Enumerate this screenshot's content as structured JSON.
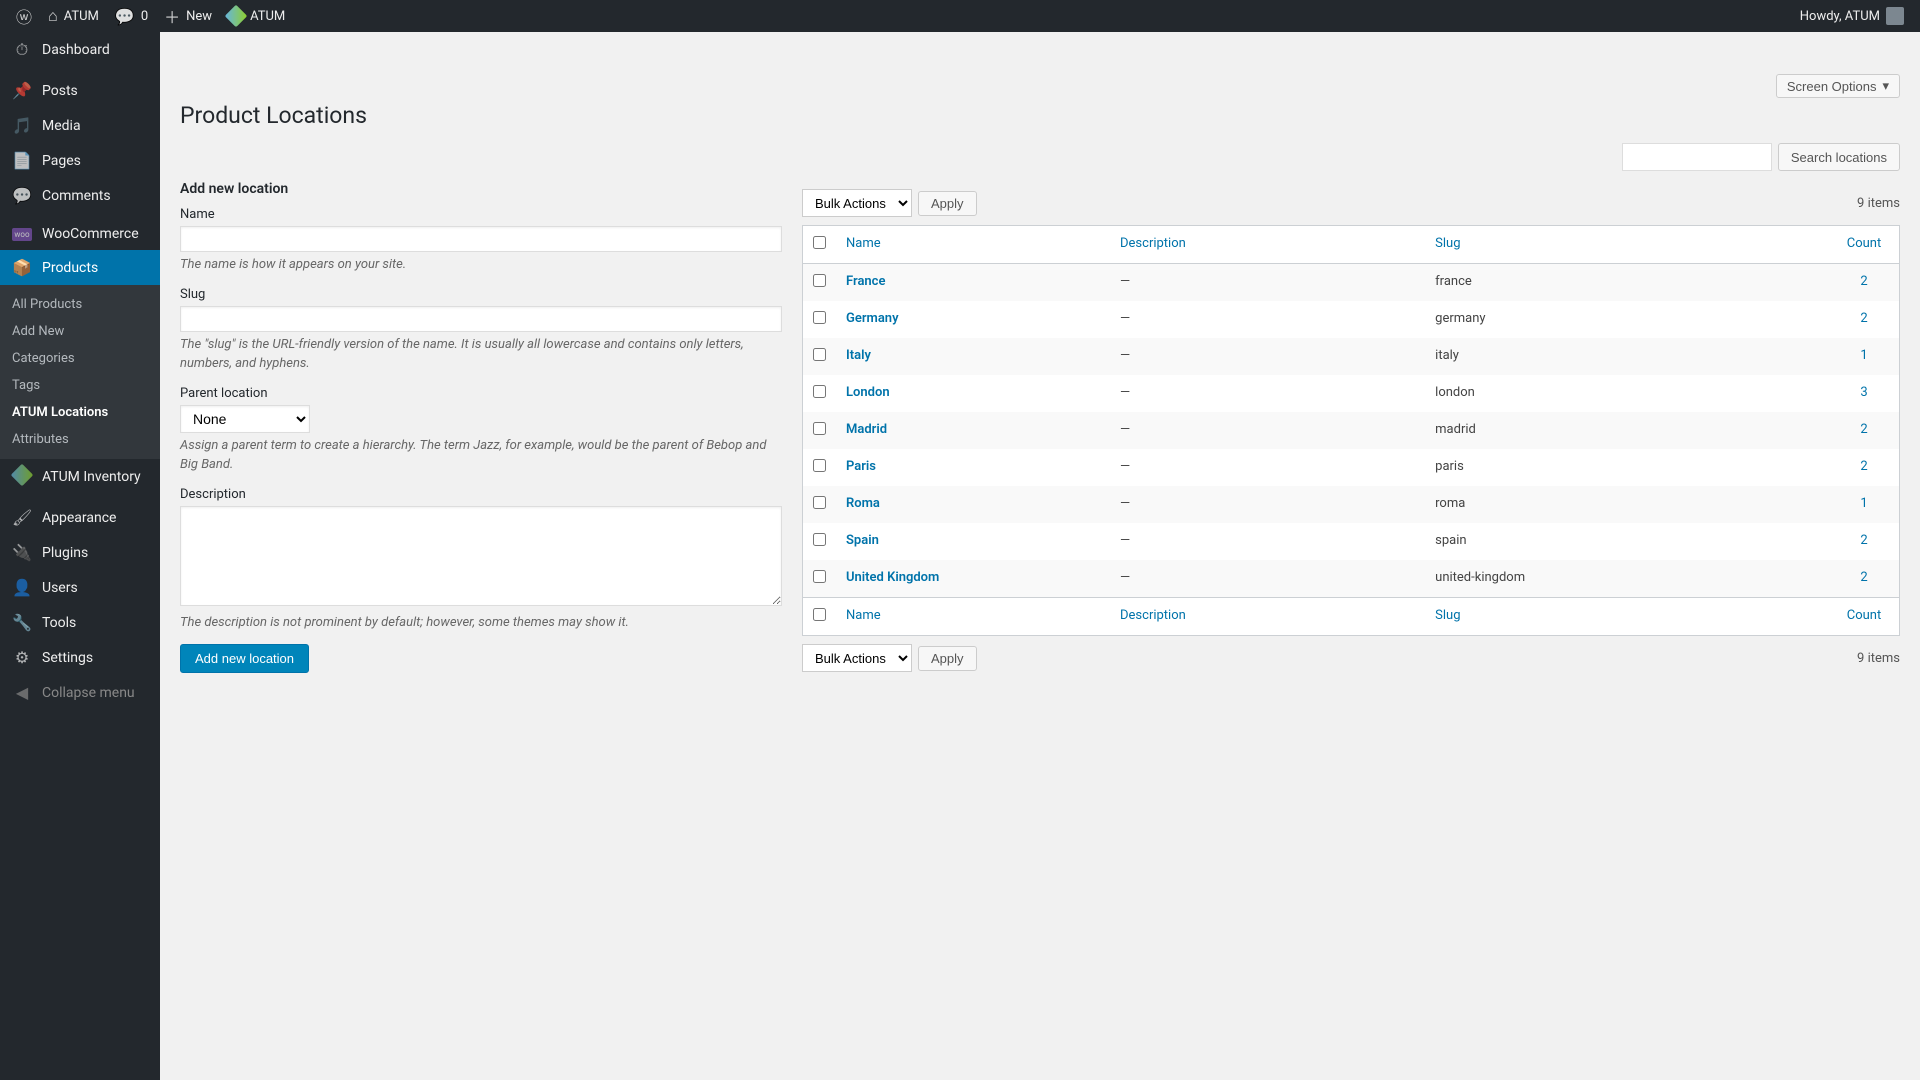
{
  "adminBar": {
    "siteName": "ATUM",
    "commentCount": "0",
    "newLabel": "New",
    "atumLabel": "ATUM",
    "howdy": "Howdy, ATUM"
  },
  "sidebar": {
    "items": [
      {
        "icon": "⏱",
        "label": "Dashboard"
      },
      {
        "icon": "📌",
        "label": "Posts"
      },
      {
        "icon": "🎵",
        "label": "Media"
      },
      {
        "icon": "📄",
        "label": "Pages"
      },
      {
        "icon": "💬",
        "label": "Comments"
      },
      {
        "icon": "woo",
        "label": "WooCommerce"
      },
      {
        "icon": "📦",
        "label": "Products",
        "current": true
      },
      {
        "icon": "atum",
        "label": "ATUM Inventory"
      },
      {
        "icon": "🖌",
        "label": "Appearance"
      },
      {
        "icon": "🔌",
        "label": "Plugins"
      },
      {
        "icon": "👤",
        "label": "Users"
      },
      {
        "icon": "🔧",
        "label": "Tools"
      },
      {
        "icon": "⚙",
        "label": "Settings"
      }
    ],
    "submenu": [
      {
        "label": "All Products"
      },
      {
        "label": "Add New"
      },
      {
        "label": "Categories"
      },
      {
        "label": "Tags"
      },
      {
        "label": "ATUM Locations",
        "active": true
      },
      {
        "label": "Attributes"
      }
    ],
    "collapse": "Collapse menu"
  },
  "screenOptions": "Screen Options",
  "pageTitle": "Product Locations",
  "searchButton": "Search locations",
  "form": {
    "title": "Add new location",
    "name": {
      "label": "Name",
      "help": "The name is how it appears on your site."
    },
    "slug": {
      "label": "Slug",
      "help": "The \"slug\" is the URL-friendly version of the name. It is usually all lowercase and contains only letters, numbers, and hyphens."
    },
    "parent": {
      "label": "Parent location",
      "selected": "None",
      "help": "Assign a parent term to create a hierarchy. The term Jazz, for example, would be the parent of Bebop and Big Band."
    },
    "description": {
      "label": "Description",
      "help": "The description is not prominent by default; however, some themes may show it."
    },
    "submit": "Add new location"
  },
  "table": {
    "bulkActions": "Bulk Actions",
    "apply": "Apply",
    "itemCount": "9 items",
    "columns": {
      "name": "Name",
      "description": "Description",
      "slug": "Slug",
      "count": "Count"
    },
    "rows": [
      {
        "name": "France",
        "description": "—",
        "slug": "france",
        "count": "2"
      },
      {
        "name": "Germany",
        "description": "—",
        "slug": "germany",
        "count": "2"
      },
      {
        "name": "Italy",
        "description": "—",
        "slug": "italy",
        "count": "1"
      },
      {
        "name": "London",
        "description": "—",
        "slug": "london",
        "count": "3"
      },
      {
        "name": "Madrid",
        "description": "—",
        "slug": "madrid",
        "count": "2"
      },
      {
        "name": "Paris",
        "description": "—",
        "slug": "paris",
        "count": "2"
      },
      {
        "name": "Roma",
        "description": "—",
        "slug": "roma",
        "count": "1"
      },
      {
        "name": "Spain",
        "description": "—",
        "slug": "spain",
        "count": "2"
      },
      {
        "name": "United Kingdom",
        "description": "—",
        "slug": "united-kingdom",
        "count": "2"
      }
    ]
  }
}
